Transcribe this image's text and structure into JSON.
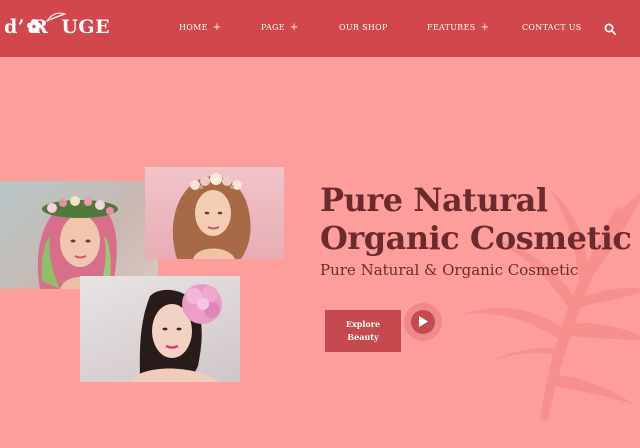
{
  "brand": {
    "logo_prefix": "d’ R",
    "logo_suffix": "UGE"
  },
  "nav": {
    "items": [
      {
        "label": "HOME",
        "plus": "+"
      },
      {
        "label": "PAGE",
        "plus": "+"
      },
      {
        "label": "OUR SHOP",
        "plus": ""
      },
      {
        "label": "FEATURES",
        "plus": "+"
      },
      {
        "label": "CONTACT US",
        "plus": ""
      }
    ],
    "search_icon": "search-icon"
  },
  "hero": {
    "title_line1": "Pure Natural",
    "title_line2": "Organic Cosmetic",
    "subtitle": "Pure Natural & Organic Cosmetic",
    "button_line1": "Explore",
    "button_line2": "Beauty",
    "play_icon": "play-icon"
  },
  "colors": {
    "header": "#d1474c",
    "background": "#fd9e9c",
    "heading": "#6b2a2c",
    "button": "#c44a50"
  }
}
